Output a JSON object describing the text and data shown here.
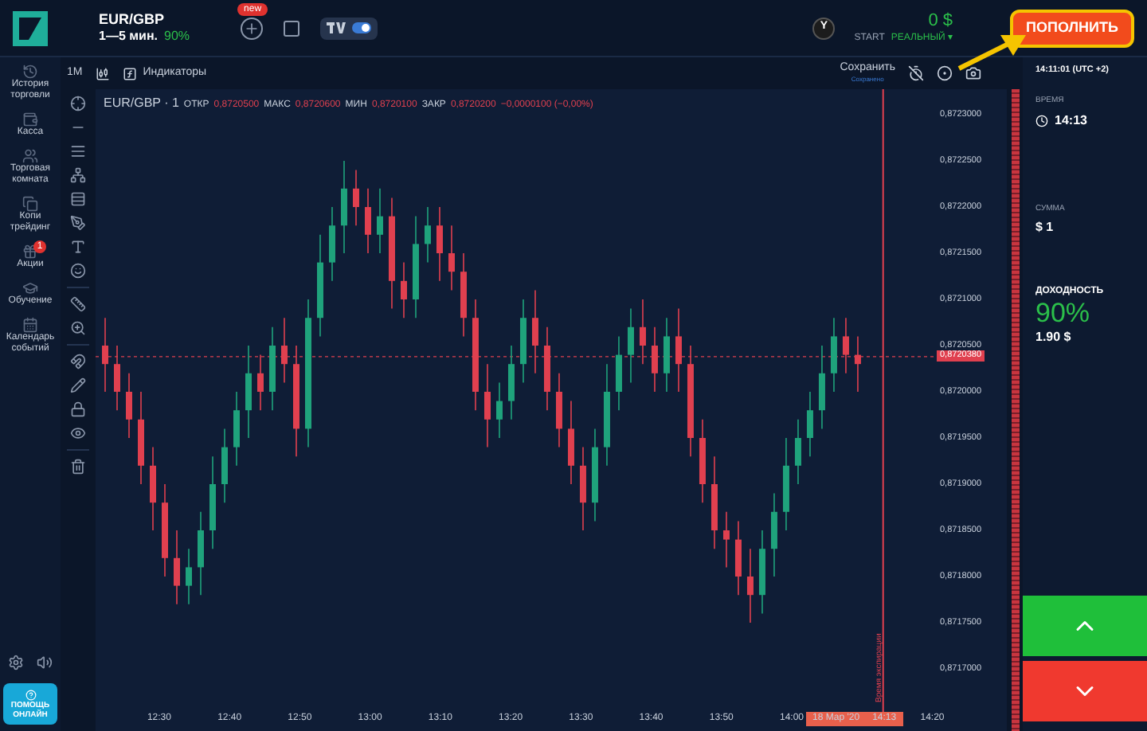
{
  "topbar": {
    "asset": "EUR/GBP",
    "expiry": "1—5 мин.",
    "payout": "90%",
    "new_badge": "new",
    "tv_toggle": {
      "on": true
    },
    "avatar": "Y",
    "balance": "0 $",
    "account_label": "START",
    "account_type": "РЕАЛЬНЫЙ ▾",
    "deposit_button": "ПОПОЛНИТЬ"
  },
  "sidebar": {
    "items": [
      {
        "label": "История торговли"
      },
      {
        "label": "Касса"
      },
      {
        "label": "Торговая комната"
      },
      {
        "label": "Копи трейдинг"
      },
      {
        "label": "Акции",
        "badge": "1"
      },
      {
        "label": "Обучение"
      },
      {
        "label": "Календарь событий"
      }
    ],
    "help_button": "ПОМОЩЬ ОНЛАЙН"
  },
  "chart_toolbar": {
    "timeframe": "1M",
    "indicators": "Индикаторы",
    "save": "Сохранить",
    "saved": "Сохранено"
  },
  "legend": {
    "title": "EUR/GBP · 1",
    "open_label": "ОТКР",
    "open": "0,8720500",
    "high_label": "МАКС",
    "high": "0,8720600",
    "low_label": "МИН",
    "low": "0,8720100",
    "close_label": "ЗАКР",
    "close": "0,8720200",
    "change": "−0,0000100 (−0,00%)"
  },
  "chart": {
    "chart_data": {
      "type": "candlestick",
      "x": [
        742.3,
        744,
        745.7,
        747.4,
        749.1,
        750.8,
        752.5,
        754.2,
        755.9,
        757.6,
        759.3,
        761,
        762.7,
        764.4,
        766.1,
        767.8,
        769.5,
        771.2,
        772.9,
        774.6,
        776.3,
        778,
        779.7,
        781.4,
        783.1,
        784.8,
        786.5,
        788.2,
        789.9,
        791.6,
        793.3,
        795,
        796.7,
        798.4,
        800.1,
        801.8,
        803.5,
        805.2,
        806.9,
        808.6,
        810.3,
        812,
        813.7,
        815.4,
        817.1,
        818.8,
        820.5,
        822.2,
        823.9,
        825.6,
        827.3,
        829,
        830.7,
        832.4,
        834.1,
        835.8,
        837.5,
        839.2,
        840.9,
        842.6,
        844.3,
        846,
        847.7,
        849.4
      ],
      "ohlc": [
        [
          0.87205,
          0.87208,
          0.872,
          0.87203
        ],
        [
          0.87203,
          0.87205,
          0.87198,
          0.872
        ],
        [
          0.872,
          0.87202,
          0.87195,
          0.87197
        ],
        [
          0.87197,
          0.872,
          0.8719,
          0.87192
        ],
        [
          0.87192,
          0.87194,
          0.87185,
          0.87188
        ],
        [
          0.87188,
          0.8719,
          0.8718,
          0.87182
        ],
        [
          0.87182,
          0.87185,
          0.87177,
          0.87179
        ],
        [
          0.87179,
          0.87183,
          0.87177,
          0.87181
        ],
        [
          0.87181,
          0.87187,
          0.87178,
          0.87185
        ],
        [
          0.87185,
          0.87193,
          0.87183,
          0.8719
        ],
        [
          0.8719,
          0.87196,
          0.87188,
          0.87194
        ],
        [
          0.87194,
          0.872,
          0.87192,
          0.87198
        ],
        [
          0.87198,
          0.87205,
          0.87195,
          0.87202
        ],
        [
          0.87202,
          0.87204,
          0.87198,
          0.872
        ],
        [
          0.872,
          0.87207,
          0.87198,
          0.87205
        ],
        [
          0.87205,
          0.87208,
          0.87201,
          0.87203
        ],
        [
          0.87203,
          0.87205,
          0.87193,
          0.87196
        ],
        [
          0.87196,
          0.8721,
          0.87194,
          0.87208
        ],
        [
          0.87208,
          0.87217,
          0.87206,
          0.87214
        ],
        [
          0.87214,
          0.8722,
          0.87212,
          0.87218
        ],
        [
          0.87218,
          0.87225,
          0.87215,
          0.87222
        ],
        [
          0.87222,
          0.87224,
          0.87218,
          0.8722
        ],
        [
          0.8722,
          0.87222,
          0.87215,
          0.87217
        ],
        [
          0.87217,
          0.87222,
          0.87215,
          0.87219
        ],
        [
          0.87219,
          0.87221,
          0.87209,
          0.87212
        ],
        [
          0.87212,
          0.87214,
          0.87208,
          0.8721
        ],
        [
          0.8721,
          0.87219,
          0.87208,
          0.87216
        ],
        [
          0.87216,
          0.8722,
          0.87214,
          0.87218
        ],
        [
          0.87218,
          0.8722,
          0.87212,
          0.87215
        ],
        [
          0.87215,
          0.87218,
          0.87211,
          0.87213
        ],
        [
          0.87213,
          0.87215,
          0.87206,
          0.87208
        ],
        [
          0.87208,
          0.8721,
          0.87198,
          0.872
        ],
        [
          0.872,
          0.87203,
          0.87194,
          0.87197
        ],
        [
          0.87197,
          0.87201,
          0.87195,
          0.87199
        ],
        [
          0.87199,
          0.87205,
          0.87197,
          0.87203
        ],
        [
          0.87203,
          0.8721,
          0.87201,
          0.87208
        ],
        [
          0.87208,
          0.87211,
          0.87202,
          0.87205
        ],
        [
          0.87205,
          0.87207,
          0.87198,
          0.872
        ],
        [
          0.872,
          0.87202,
          0.87194,
          0.87196
        ],
        [
          0.87196,
          0.87199,
          0.8719,
          0.87192
        ],
        [
          0.87192,
          0.87194,
          0.87185,
          0.87188
        ],
        [
          0.87188,
          0.87196,
          0.87186,
          0.87194
        ],
        [
          0.87194,
          0.87203,
          0.87192,
          0.872
        ],
        [
          0.872,
          0.87206,
          0.87198,
          0.87204
        ],
        [
          0.87204,
          0.87209,
          0.87201,
          0.87207
        ],
        [
          0.87207,
          0.8721,
          0.87203,
          0.87205
        ],
        [
          0.87205,
          0.87207,
          0.872,
          0.87202
        ],
        [
          0.87202,
          0.87208,
          0.872,
          0.87206
        ],
        [
          0.87206,
          0.87209,
          0.872,
          0.87203
        ],
        [
          0.87203,
          0.87205,
          0.87193,
          0.87195
        ],
        [
          0.87195,
          0.87197,
          0.87188,
          0.8719
        ],
        [
          0.8719,
          0.87193,
          0.87183,
          0.87185
        ],
        [
          0.87185,
          0.87187,
          0.87181,
          0.87184
        ],
        [
          0.87184,
          0.87186,
          0.87178,
          0.8718
        ],
        [
          0.8718,
          0.87183,
          0.87175,
          0.87178
        ],
        [
          0.87178,
          0.87185,
          0.87176,
          0.87183
        ],
        [
          0.87183,
          0.87189,
          0.8718,
          0.87187
        ],
        [
          0.87187,
          0.87195,
          0.87185,
          0.87192
        ],
        [
          0.87192,
          0.87197,
          0.8719,
          0.87195
        ],
        [
          0.87195,
          0.872,
          0.87193,
          0.87198
        ],
        [
          0.87198,
          0.87205,
          0.87196,
          0.87202
        ],
        [
          0.87202,
          0.87208,
          0.872,
          0.87206
        ],
        [
          0.87206,
          0.87208,
          0.87202,
          0.87204
        ],
        [
          0.87204,
          0.87206,
          0.872,
          0.87203
        ]
      ],
      "xlim": [
        740.94,
        870.6
      ],
      "ylim": [
        0.8717,
        0.8723
      ],
      "ref_lines": [
        {
          "axis": "y",
          "value": 0.872038,
          "label": "0,8720380",
          "color": "#e0404f"
        },
        {
          "axis": "x",
          "value": 853,
          "label": "Время экспирации",
          "color": "#e0404f"
        }
      ],
      "yticks": [
        {
          "value": 0.8723,
          "label": "0,8723000"
        },
        {
          "value": 0.87225,
          "label": "0,8722500"
        },
        {
          "value": 0.8722,
          "label": "0,8722000"
        },
        {
          "value": 0.87215,
          "label": "0,8721500"
        },
        {
          "value": 0.8721,
          "label": "0,8721000"
        },
        {
          "value": 0.87205,
          "label": "0,8720500"
        },
        {
          "value": 0.872,
          "label": "0,8720000"
        },
        {
          "value": 0.87195,
          "label": "0,8719500"
        },
        {
          "value": 0.8719,
          "label": "0,8719000"
        },
        {
          "value": 0.87185,
          "label": "0,8718500"
        },
        {
          "value": 0.8718,
          "label": "0,8718000"
        },
        {
          "value": 0.87175,
          "label": "0,8717500"
        },
        {
          "value": 0.8717,
          "label": "0,8717000"
        }
      ],
      "xticks": [
        {
          "value": 750,
          "label": "12:30"
        },
        {
          "value": 760,
          "label": "12:40"
        },
        {
          "value": 770,
          "label": "12:50"
        },
        {
          "value": 780,
          "label": "13:00"
        },
        {
          "value": 790,
          "label": "13:10"
        },
        {
          "value": 800,
          "label": "13:20"
        },
        {
          "value": 810,
          "label": "13:30"
        },
        {
          "value": 820,
          "label": "13:40"
        },
        {
          "value": 830,
          "label": "13:50"
        },
        {
          "value": 840,
          "label": "14:00"
        },
        {
          "value": 860,
          "label": "14:20"
        }
      ]
    },
    "cursor_date": "18 Мар '20",
    "cursor_time": "14:13"
  },
  "trade_panel": {
    "clock": "14:11:01 (UTC +2)",
    "time_label": "ВРЕМЯ",
    "time": "14:13",
    "amount_label": "СУММА",
    "amount": "$ 1",
    "profit_label": "ДОХОДНОСТЬ",
    "profit_percent": "90%",
    "profit_amount": "1.90 $"
  }
}
